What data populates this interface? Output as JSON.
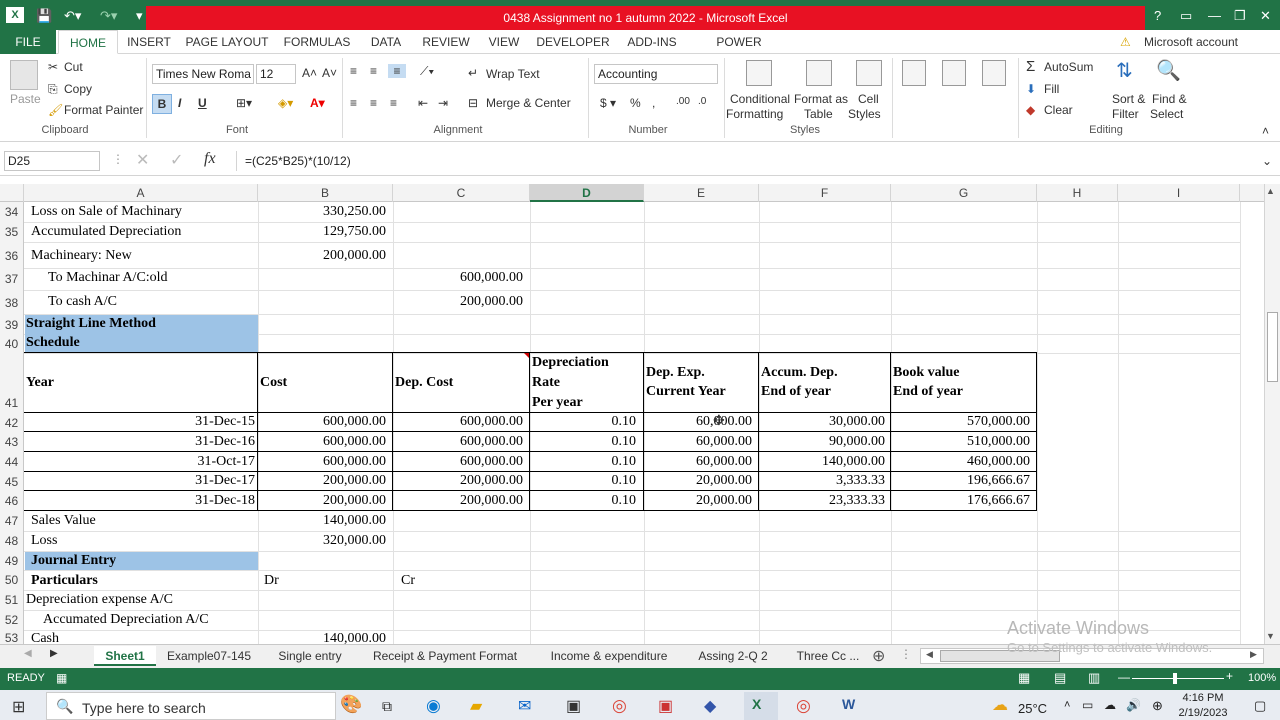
{
  "window": {
    "title": "0438 Assignment no 1 autumn 2022  -  Microsoft Excel"
  },
  "ribbon_tabs": [
    "FILE",
    "HOME",
    "INSERT",
    "PAGE LAYOUT",
    "FORMULAS",
    "DATA",
    "REVIEW",
    "VIEW",
    "DEVELOPER",
    "ADD-INS",
    "POWER QUERY"
  ],
  "account": "Microsoft account",
  "clipboard": {
    "paste": "Paste",
    "cut": "Cut",
    "copy": "Copy",
    "format_painter": "Format Painter",
    "label": "Clipboard"
  },
  "font": {
    "name": "Times New Roma",
    "size": "12",
    "label": "Font"
  },
  "alignment": {
    "wrap": "Wrap Text",
    "merge": "Merge & Center",
    "label": "Alignment"
  },
  "number": {
    "format": "Accounting",
    "label": "Number"
  },
  "styles": {
    "conditional": "Conditional",
    "conditional2": "Formatting",
    "format_as": "Format as",
    "format_as2": "Table",
    "cell": "Cell",
    "cell2": "Styles",
    "label": "Styles"
  },
  "cells": {
    "r34a": "Loss on Sale of Machinary",
    "r34b": "330,250.00",
    "r35a": "Accumulated Depreciation",
    "r35b": "129,750.00",
    "r36a": "Machineary: New",
    "r36b": "200,000.00",
    "r37a": "To Machinar A/C:old",
    "r37c": "600,000.00",
    "r38a": "To cash A/C",
    "r38c": "200,000.00",
    "r39a": "Straight Line Method",
    "r40a": "Schedule",
    "h_year": "Year",
    "h_cost": "Cost",
    "h_dep": "Dep. Cost",
    "h_rate1": "Depreciation",
    "h_rate2": "Rate",
    "h_rate3": "Per year",
    "h_exp1": "Dep. Exp.",
    "h_exp2": "Current Year",
    "h_acc1": "Accum. Dep.",
    "h_acc2": "End of year",
    "h_bv1": "Book value",
    "h_bv2": "End of year",
    "r47a": "Sales Value",
    "r47b": "140,000.00",
    "r48a": "Loss",
    "r48b": "320,000.00",
    "r49a": "Journal Entry",
    "r50a": "Particulars",
    "r50b": "Dr",
    "r50c": "Cr",
    "r51a": "Depreciation expense A/C",
    "r52a": "Accumated Depreciation A/C",
    "r53a": "Cash",
    "r53b": "140,000.00"
  },
  "editing": {
    "autosum": "AutoSum",
    "fill": "Fill",
    "clear": "Clear",
    "sort": "Sort &",
    "sort2": "Filter",
    "find": "Find &",
    "find2": "Select",
    "label": "Editing"
  },
  "formula_bar": {
    "name_box": "D25",
    "formula": "=(C25*B25)*(10/12)"
  },
  "columns": [
    "A",
    "B",
    "C",
    "D",
    "E",
    "F",
    "G",
    "H",
    "I"
  ],
  "rows": [
    "34",
    "35",
    "36",
    "37",
    "38",
    "39",
    "40",
    "41",
    "42",
    "43",
    "44",
    "45",
    "46",
    "47",
    "48",
    "49",
    "50",
    "51",
    "52",
    "53"
  ],
  "schedule": [
    {
      "year": "31-Dec-15",
      "cost": "600,000.00",
      "dep": "600,000.00",
      "rate": "0.10",
      "exp": "60,000.00",
      "acc": "30,000.00",
      "bv": "570,000.00"
    },
    {
      "year": "31-Dec-16",
      "cost": "600,000.00",
      "dep": "600,000.00",
      "rate": "0.10",
      "exp": "60,000.00",
      "acc": "90,000.00",
      "bv": "510,000.00"
    },
    {
      "year": "31-Oct-17",
      "cost": "600,000.00",
      "dep": "600,000.00",
      "rate": "0.10",
      "exp": "60,000.00",
      "acc": "140,000.00",
      "bv": "460,000.00"
    },
    {
      "year": "31-Dec-17",
      "cost": "200,000.00",
      "dep": "200,000.00",
      "rate": "0.10",
      "exp": "20,000.00",
      "acc": "3,333.33",
      "bv": "196,666.67"
    },
    {
      "year": "31-Dec-18",
      "cost": "200,000.00",
      "dep": "200,000.00",
      "rate": "0.10",
      "exp": "20,000.00",
      "acc": "23,333.33",
      "bv": "176,666.67"
    }
  ],
  "sheets": [
    "Sheet1",
    "Example07-145",
    "Single entry",
    "Receipt & Payment Format",
    "Income & expenditure",
    "Assing 2-Q 2",
    "Three Cc ..."
  ],
  "status": {
    "ready": "READY",
    "zoom": "100%"
  },
  "watermark": {
    "line1": "Activate Windows",
    "line2": "Go to Settings to activate Windows."
  },
  "taskbar": {
    "search": "Type here to search",
    "weather": "25°C",
    "time": "4:16 PM",
    "date": "2/19/2023"
  },
  "colors": {
    "excel_green": "#217346",
    "title_red": "#e81123",
    "header_blue": "#9dc3e6"
  }
}
